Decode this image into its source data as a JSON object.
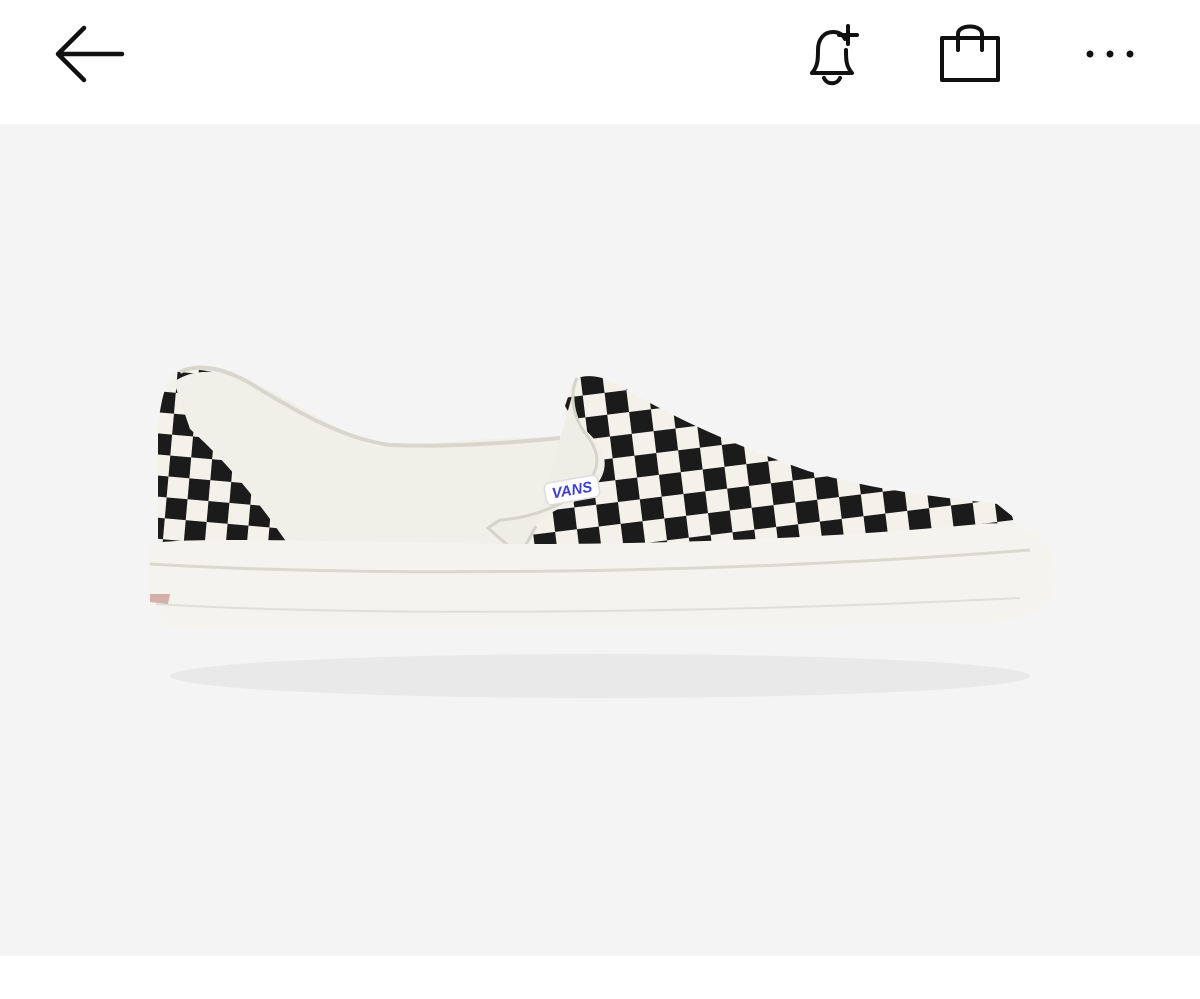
{
  "header": {
    "back_icon": "arrow-left-icon",
    "alert_icon": "bell-plus-icon",
    "bag_icon": "shopping-bag-icon",
    "more_icon": "more-horizontal-icon"
  },
  "product": {
    "image_icon": "checkerboard-slip-on-sneaker-image",
    "logo_text": "VANS",
    "colors": {
      "background": "#f4f4f4",
      "check_dark": "#1b1b1b",
      "check_light": "#f3f1ea",
      "sole": "#f4f3ee",
      "logo_blue": "#3c3fd0"
    }
  }
}
